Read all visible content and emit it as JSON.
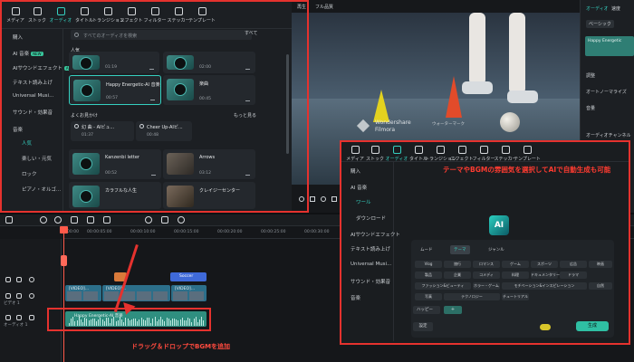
{
  "lib_tabs": [
    "メディア",
    "ストック",
    "オーディオ",
    "タイトル",
    "トランジション",
    "エフェクト",
    "フィルター",
    "ステッカー",
    "テンプレート"
  ],
  "sidebar": {
    "items": [
      "購入",
      "AI 音楽",
      "AIサウンドエフェクト",
      "テキスト読み上げ",
      "Universal Musi...",
      "サウンド・効果音",
      "音楽",
      "人気",
      "楽しい・元気",
      "ロック",
      "ピアノ・オルゴ..."
    ],
    "ai_badge": "AI",
    "new_badge": "NEW"
  },
  "search": {
    "placeholder": "すべてのオーディオを検索",
    "filter": "すべて"
  },
  "sections": {
    "ai": "人気",
    "recommended": "よくお見かけ",
    "more": "もっと見る"
  },
  "tracks": [
    {
      "name": "",
      "dur": "01:19"
    },
    {
      "name": "",
      "dur": "02:00"
    },
    {
      "name": "Happy Energetic-AI 音楽",
      "dur": "00:57"
    },
    {
      "name": "楽曲",
      "dur": "00:45"
    },
    {
      "name": "Kanzenbi letter",
      "dur": "00:52"
    },
    {
      "name": "Arrows",
      "dur": "03:12"
    },
    {
      "name": "カラフルな人生",
      "dur": ""
    },
    {
      "name": "クレイジーセンター",
      "dur": ""
    }
  ],
  "recommended": [
    {
      "name": "幻 曲 - AIビュ...",
      "dur": "01:37"
    },
    {
      "name": "Cheer Up-AIビ...",
      "dur": "00:48"
    }
  ],
  "preview": {
    "label": "再生",
    "quality": "フル品質",
    "wm1": "Wondershare",
    "wm2": "Filmora",
    "wm3": "ウォーターマーク"
  },
  "props": {
    "tab1": "オーディオ",
    "tab2": "速度",
    "sub": "ベーシック",
    "clip": "Happy Energetic",
    "adjust": "調整",
    "normalize": "オートノーマライズ",
    "volume": "音量",
    "channel": "オーディオチャンネル"
  },
  "ruler": [
    "00:00",
    "00:00:05:00",
    "00:00:10:00",
    "00:00:15:00",
    "00:00:20:00",
    "00:00:25:00",
    "00:00:30:00"
  ],
  "tracks_tl": {
    "video": "ビデオ 1",
    "audio": "オーディオ 1"
  },
  "clips": [
    "[VIDEO]...",
    "[VIDEO]...",
    "[VIDEO]..."
  ],
  "sticker": "Soccer",
  "audio_clip": "Happy Energetic-AI 音楽",
  "popup": {
    "headline": "テーマやBGMの雰囲気を選択してAIで自動生成も可能",
    "tabs": [
      "メディア",
      "ストック",
      "オーディオ",
      "タイトル",
      "トランジション",
      "エフェクト",
      "フィルター",
      "ステッカー",
      "テンプレート"
    ],
    "side": [
      "購入",
      "AI 音楽",
      "ワール",
      "ダウンロード",
      "AIサウンドエフェクト",
      "テキスト読み上げ",
      "Universal Musi...",
      "サウンド・効果音",
      "音楽"
    ],
    "mode_tabs": [
      "ムード",
      "テーマ",
      "ジャンル"
    ],
    "chips": [
      "Vlog",
      "旅行",
      "ロマンス",
      "ゲーム",
      "スポーツ",
      "広告",
      "映画",
      "製品",
      "企業",
      "コメディ",
      "料理",
      "ドキュメンタリー",
      "ドラマ",
      "ファッション&ビューティ",
      "ホラー・ゲーム",
      "モチベーション&インスピレーション",
      "自然",
      "写真",
      "テクノロジー",
      "チュートリアル"
    ],
    "selected": "ハッピー",
    "plus": "+",
    "settings": "設定",
    "generate": "生成"
  },
  "annotation": "ドラッグ＆ドロップでBGMを追加",
  "colors": {
    "accent": "#35d0c0",
    "highlight": "#e5322e",
    "audio": "#2f8f80"
  }
}
